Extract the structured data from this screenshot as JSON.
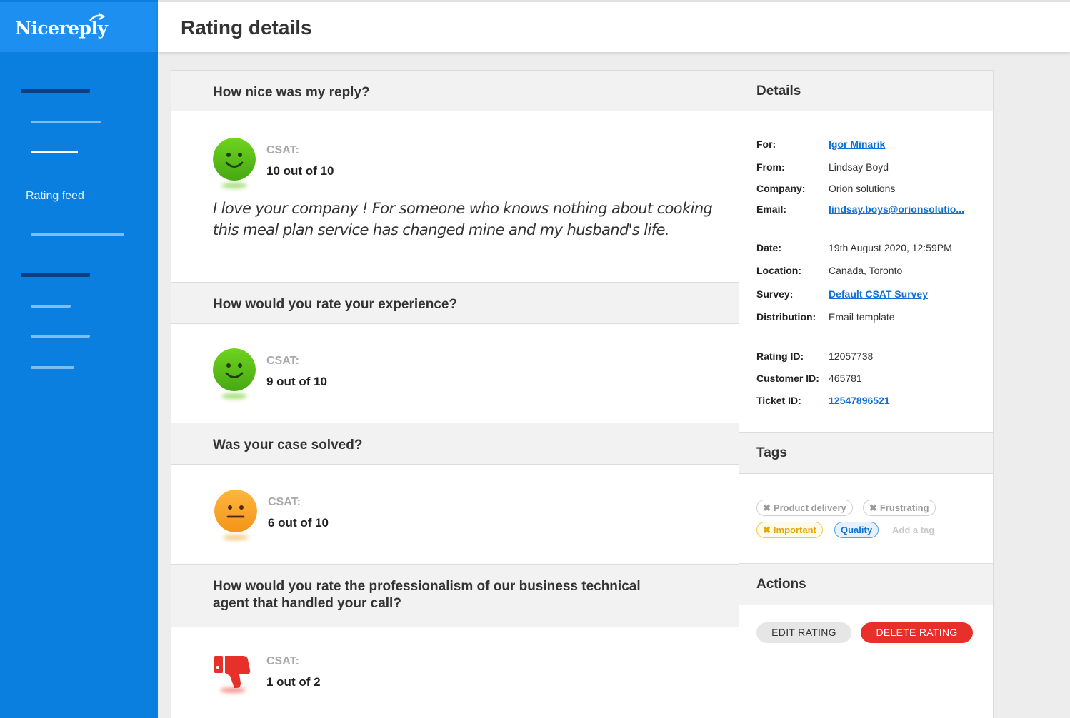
{
  "app": {
    "logo": "Nicereply"
  },
  "sidebar": {
    "rating_feed_label": "Rating feed"
  },
  "header": {
    "title": "Rating details"
  },
  "questions": [
    {
      "title": "How nice was my reply?",
      "csat_label": "CSAT:",
      "score": "10 out of 10",
      "face": "happy-face-icon",
      "comment": "I love your company ! For someone who knows nothing about cooking this meal plan service has changed mine and my husband's life."
    },
    {
      "title": "How would you rate your experience?",
      "csat_label": "CSAT:",
      "score": "9 out of 10",
      "face": "happy-face-icon"
    },
    {
      "title": "Was your case solved?",
      "csat_label": "CSAT:",
      "score": "6 out of 10",
      "face": "neutral-face-icon"
    },
    {
      "title_line1": "How would you rate the professionalism of our business technical",
      "title_line2": "agent that handled your call?",
      "csat_label": "CSAT:",
      "score": "1 out of 2",
      "face": "thumbs-down-icon"
    }
  ],
  "details": {
    "title": "Details",
    "for_label": "For:",
    "for_value": "Igor Minarik",
    "from_label": "From:",
    "from_value": "Lindsay Boyd",
    "company_label": "Company:",
    "company_value": "Orion solutions",
    "email_label": "Email:",
    "email_value": "lindsay.boys@orionsolutio...",
    "date_label": "Date:",
    "date_value": "19th August 2020, 12:59PM",
    "location_label": "Location:",
    "location_value": "Canada, Toronto",
    "survey_label": "Survey:",
    "survey_value": "Default CSAT Survey",
    "distribution_label": "Distribution:",
    "distribution_value": "Email template",
    "rating_id_label": "Rating ID:",
    "rating_id_value": "12057738",
    "customer_id_label": "Customer ID:",
    "customer_id_value": "465781",
    "ticket_id_label": "Ticket ID:",
    "ticket_id_value": "12547896521"
  },
  "tags": {
    "title": "Tags",
    "items": [
      "Product delivery",
      "Frustrating",
      "Important",
      "Quality"
    ],
    "add_placeholder": "Add a tag"
  },
  "actions": {
    "title": "Actions",
    "edit_label": "EDIT RATING",
    "delete_label": "DELETE RATING"
  },
  "colors": {
    "sidebar": "#0a7fe0",
    "link": "#1170d3",
    "delete": "#e8302b",
    "happy": "#5cbf1a",
    "neutral": "#f5a623"
  }
}
